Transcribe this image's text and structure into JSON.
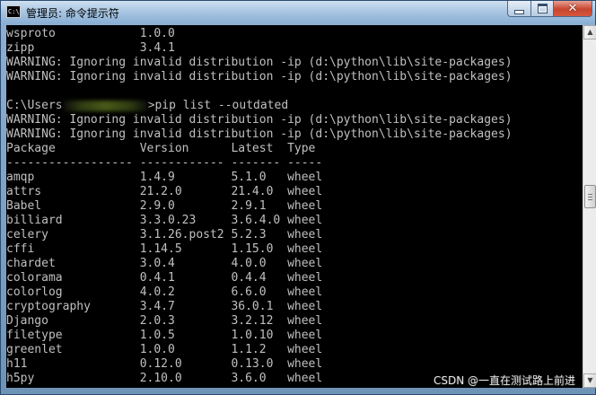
{
  "window": {
    "icon_text": "C:\\",
    "title": "管理员: 命令提示符",
    "close_glyph": "✕"
  },
  "console": {
    "lines": [
      "wsproto            1.0.0",
      "zipp               3.4.1",
      "WARNING: Ignoring invalid distribution -ip (d:\\python\\lib\\site-packages)",
      "WARNING: Ignoring invalid distribution -ip (d:\\python\\lib\\site-packages)",
      "",
      "__PROMPT__",
      "WARNING: Ignoring invalid distribution -ip (d:\\python\\lib\\site-packages)",
      "WARNING: Ignoring invalid distribution -ip (d:\\python\\lib\\site-packages)",
      "Package            Version      Latest  Type",
      "------------------ ------------ ------- -----",
      "amqp               1.4.9        5.1.0   wheel",
      "attrs              21.2.0       21.4.0  wheel",
      "Babel              2.9.0        2.9.1   wheel",
      "billiard           3.3.0.23     3.6.4.0 wheel",
      "celery             3.1.26.post2 5.2.3   wheel",
      "cffi               1.14.5       1.15.0  wheel",
      "chardet            3.0.4        4.0.0   wheel",
      "colorama           0.4.1        0.4.4   wheel",
      "colorlog           4.0.2        6.6.0   wheel",
      "cryptography       3.4.7        36.0.1  wheel",
      "Django             2.0.3        3.2.12  wheel",
      "filetype           1.0.5        1.0.10  wheel",
      "greenlet           1.0.0        1.1.2   wheel",
      "h11                0.12.0       0.13.0  wheel",
      "h5py               2.10.0       3.6.0   wheel"
    ],
    "prompt_path": "C:\\Users",
    "prompt_command": ">pip list --outdated"
  },
  "scrollbar": {
    "up_glyph": "▲",
    "down_glyph": "▼"
  },
  "watermark": "CSDN @一直在测试路上前进"
}
